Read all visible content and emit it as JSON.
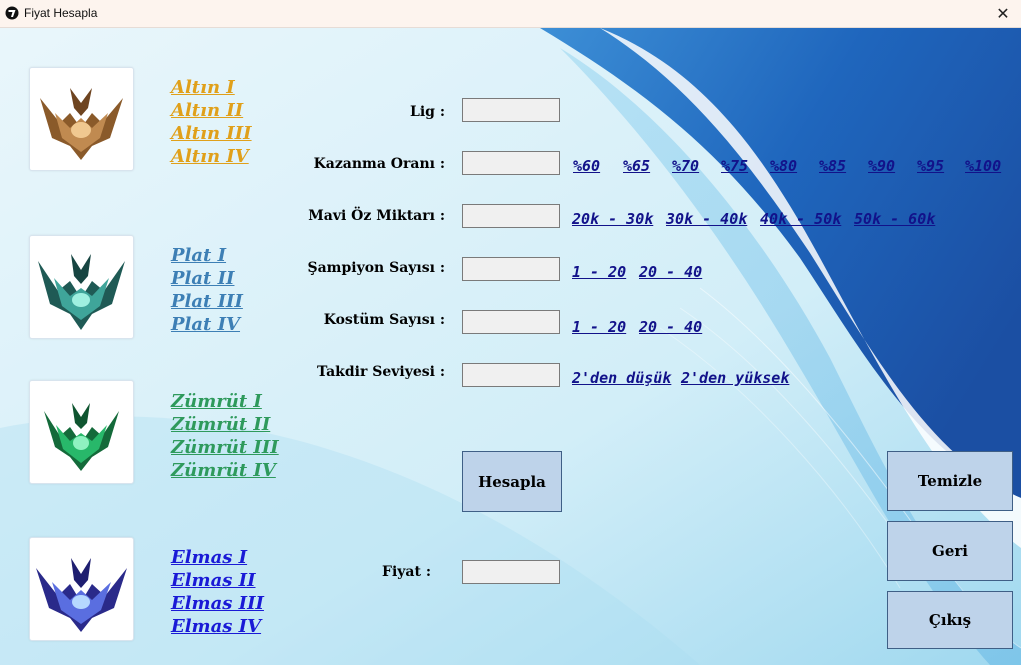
{
  "window": {
    "title": "Fiyat Hesapla",
    "close_glyph": "✕",
    "app_icon": "app-logo-icon"
  },
  "ranks": [
    {
      "name": "gold",
      "color": "#e0a01a",
      "icon": "gold-emblem-icon",
      "links": [
        "Altın I",
        "Altın II",
        "Altın III",
        "Altın IV"
      ]
    },
    {
      "name": "plat",
      "color": "#3d7fb5",
      "icon": "plat-emblem-icon",
      "links": [
        "Plat I",
        "Plat II",
        "Plat III",
        "Plat  IV"
      ]
    },
    {
      "name": "emerald",
      "color": "#2e9a5c",
      "icon": "emerald-emblem-icon",
      "links": [
        "Zümrüt  I",
        "Zümrüt II",
        "Zümrüt III",
        "Zümrüt IV"
      ]
    },
    {
      "name": "diamond",
      "color": "#1a1ad6",
      "icon": "diamond-emblem-icon",
      "links": [
        "Elmas I",
        "Elmas II",
        "Elmas III",
        "Elmas IV"
      ]
    }
  ],
  "form": {
    "lig_label": "Lig :",
    "lig_value": "",
    "win_rate_label": "Kazanma Oranı :",
    "win_rate_value": "",
    "win_rate_options": [
      "%60",
      "%65",
      "%70",
      "%75",
      "%80",
      "%85",
      "%90",
      "%95",
      "%100"
    ],
    "blue_essence_label": "Mavi Öz Miktarı :",
    "blue_essence_value": "",
    "blue_essence_options": [
      "20k - 30k",
      "30k - 40k",
      "40k - 50k",
      "50k - 60k"
    ],
    "champion_label": "Şampiyon Sayısı :",
    "champion_value": "",
    "champion_options": [
      "1 - 20",
      "20 - 40"
    ],
    "skin_label": "Kostüm Sayısı :",
    "skin_value": "",
    "skin_options": [
      "1 - 20",
      "20 - 40"
    ],
    "honor_label": "Takdir Seviyesi :",
    "honor_value": "",
    "honor_options": [
      "2'den düşük",
      "2'den yüksek"
    ],
    "price_label": "Fiyat :",
    "price_value": ""
  },
  "buttons": {
    "calculate": "Hesapla",
    "clear": "Temizle",
    "back": "Geri",
    "exit": "Çıkış"
  },
  "colors": {
    "button_bg": "#bed3ea",
    "option_link": "#12128a",
    "background_blue": "#1e5fb0"
  }
}
